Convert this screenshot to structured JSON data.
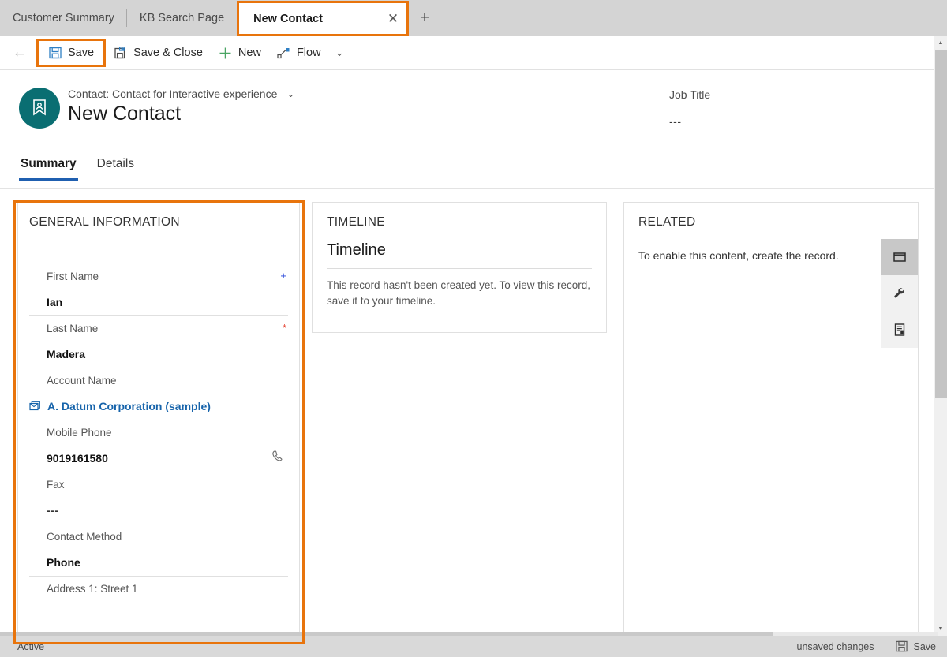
{
  "tabs": {
    "items": [
      {
        "label": "Customer Summary",
        "active": false
      },
      {
        "label": "KB Search Page",
        "active": false
      },
      {
        "label": "New Contact",
        "active": true
      }
    ],
    "close_glyph": "✕",
    "new_tab_glyph": "+"
  },
  "commandbar": {
    "back_glyph": "←",
    "items": [
      {
        "label": "Save",
        "icon": "save-icon",
        "highlighted": true
      },
      {
        "label": "Save & Close",
        "icon": "save-and-close-icon",
        "highlighted": false
      },
      {
        "label": "New",
        "icon": "plus-icon",
        "highlighted": false
      },
      {
        "label": "Flow",
        "icon": "flow-icon",
        "highlighted": false
      }
    ],
    "overflow_glyph": "⌄"
  },
  "record_header": {
    "entity_label": "Contact: Contact for Interactive experience",
    "entity_chevron": "⌄",
    "title": "New Contact",
    "avatar_icon": "contact-card-icon",
    "header_field_label": "Job Title",
    "header_field_value": "---",
    "expand_chevron": "⌄"
  },
  "form_tabs": {
    "items": [
      {
        "label": "Summary",
        "selected": true
      },
      {
        "label": "Details",
        "selected": false
      }
    ]
  },
  "general_information": {
    "section_title": "GENERAL INFORMATION",
    "fields": [
      {
        "label": "First Name",
        "value": "Ian",
        "marker": "+",
        "marker_type": "plus",
        "kind": "text"
      },
      {
        "label": "Last Name",
        "value": "Madera",
        "marker": "*",
        "marker_type": "star",
        "kind": "text"
      },
      {
        "label": "Account Name",
        "value": "A. Datum Corporation (sample)",
        "marker": "",
        "marker_type": "",
        "kind": "lookup"
      },
      {
        "label": "Mobile Phone",
        "value": "9019161580",
        "marker": "",
        "marker_type": "",
        "kind": "phone"
      },
      {
        "label": "Fax",
        "value": "---",
        "marker": "",
        "marker_type": "",
        "kind": "dim"
      },
      {
        "label": "Contact Method",
        "value": "Phone",
        "marker": "",
        "marker_type": "",
        "kind": "text"
      },
      {
        "label": "Address 1: Street 1",
        "value": "",
        "marker": "",
        "marker_type": "",
        "kind": "text"
      }
    ]
  },
  "timeline": {
    "section_title": "TIMELINE",
    "heading": "Timeline",
    "message": "This record hasn't been created yet.  To view this record, save it to your timeline."
  },
  "related": {
    "section_title": "RELATED",
    "message": "To enable this content, create the record.",
    "rail": [
      {
        "icon": "window-icon",
        "active": true
      },
      {
        "icon": "wrench-icon",
        "active": false
      },
      {
        "icon": "form-document-icon",
        "active": false
      }
    ]
  },
  "statusbar": {
    "status": "Active",
    "unsaved_text": "unsaved changes",
    "save_label": "Save",
    "save_icon": "save-icon"
  },
  "scrollbar": {
    "up_glyph": "▲",
    "down_glyph": "▼"
  },
  "colors": {
    "accent_orange": "#e8740c",
    "accent_blue": "#1f5fb0",
    "link_blue": "#1764ab",
    "avatar_teal": "#0a6e72",
    "required_red": "#e64c3c",
    "recommended_blue": "#2040d8",
    "new_green": "#4aa564"
  }
}
